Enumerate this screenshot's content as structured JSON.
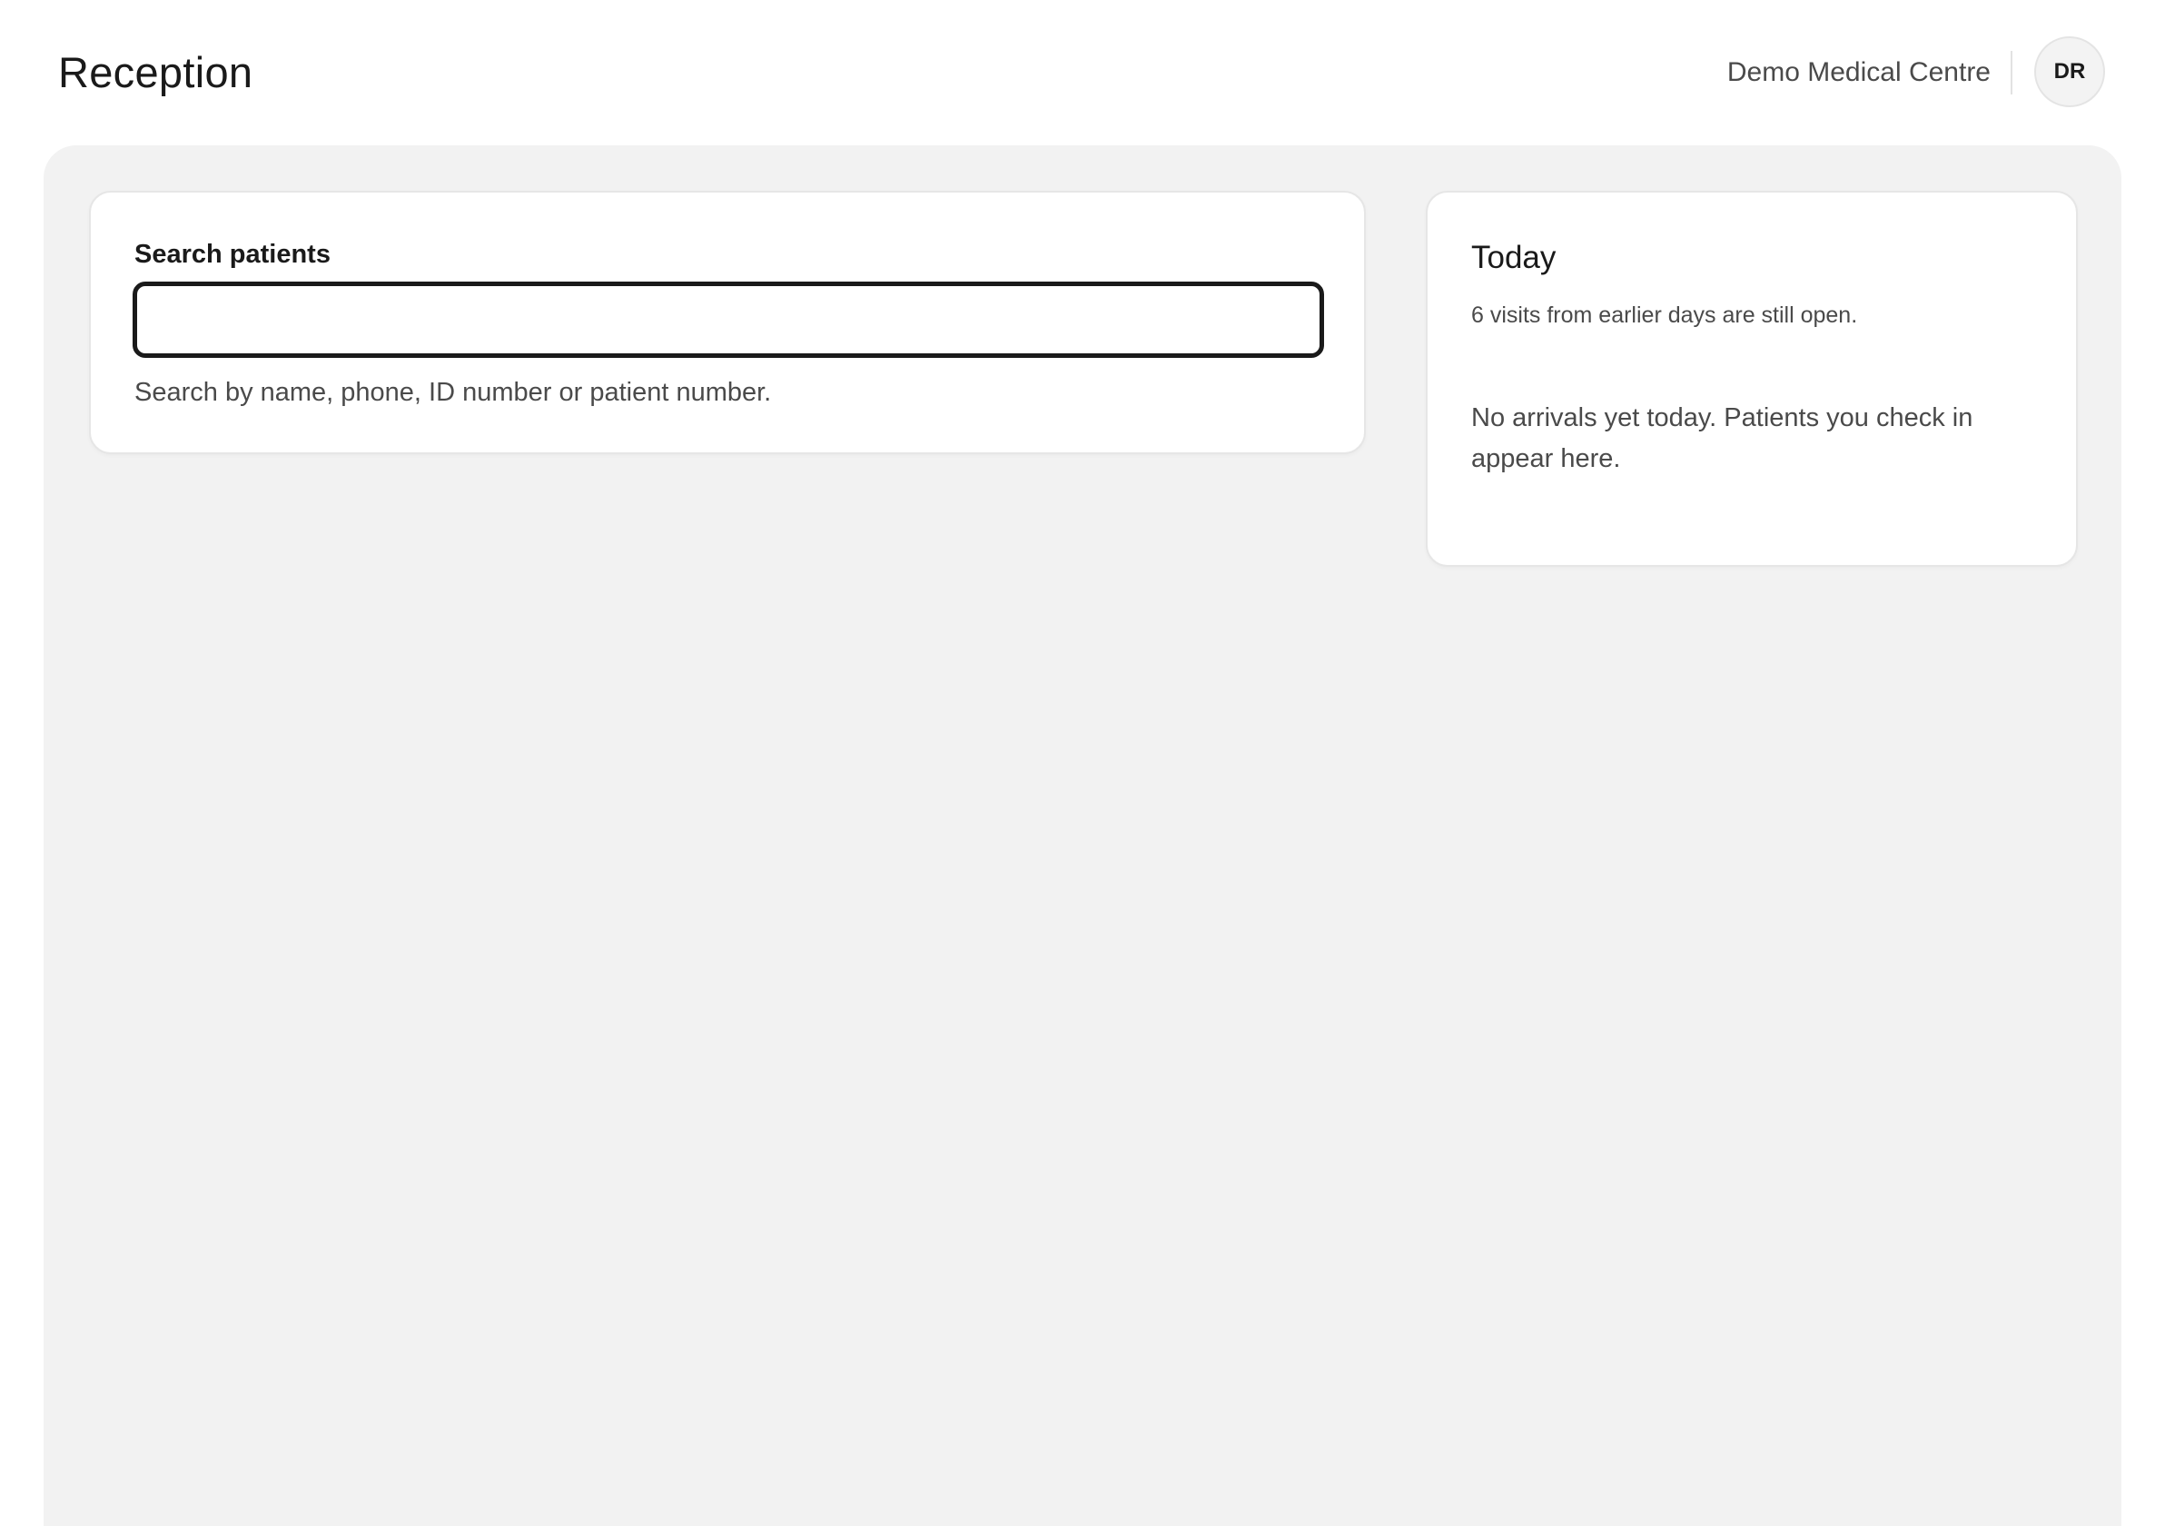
{
  "header": {
    "title": "Reception",
    "organization": "Demo Medical Centre",
    "avatar_initials": "DR"
  },
  "search": {
    "label": "Search patients",
    "value": "",
    "placeholder": "",
    "hint": "Search by name, phone, ID number or patient number."
  },
  "today": {
    "title": "Today",
    "open_visits_note": "6 visits from earlier days are still open.",
    "empty_message": "No arrivals yet today. Patients you check in appear here."
  },
  "colors": {
    "page_background": "#ffffff",
    "panel_background": "#f2f2f2",
    "card_background": "#ffffff",
    "input_border": "#1a1a1a",
    "text_primary": "#1a1a1a",
    "text_secondary": "#4a4a4a"
  }
}
